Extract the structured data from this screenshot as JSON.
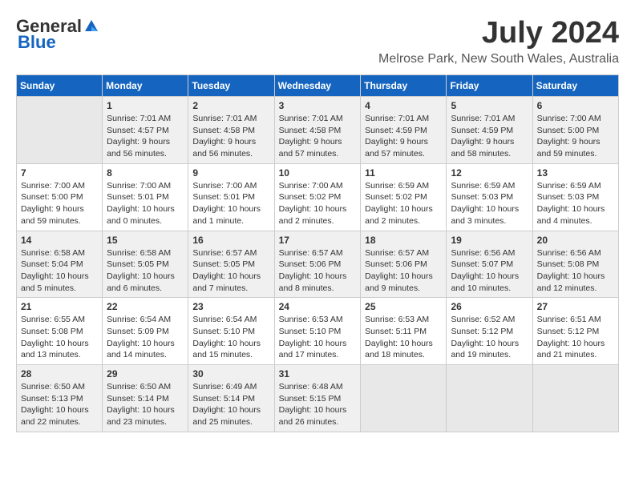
{
  "header": {
    "logo": {
      "general": "General",
      "blue": "Blue"
    },
    "title": "July 2024",
    "location": "Melrose Park, New South Wales, Australia"
  },
  "calendar": {
    "weekdays": [
      "Sunday",
      "Monday",
      "Tuesday",
      "Wednesday",
      "Thursday",
      "Friday",
      "Saturday"
    ],
    "weeks": [
      [
        {
          "day": "",
          "info": ""
        },
        {
          "day": "1",
          "info": "Sunrise: 7:01 AM\nSunset: 4:57 PM\nDaylight: 9 hours\nand 56 minutes."
        },
        {
          "day": "2",
          "info": "Sunrise: 7:01 AM\nSunset: 4:58 PM\nDaylight: 9 hours\nand 56 minutes."
        },
        {
          "day": "3",
          "info": "Sunrise: 7:01 AM\nSunset: 4:58 PM\nDaylight: 9 hours\nand 57 minutes."
        },
        {
          "day": "4",
          "info": "Sunrise: 7:01 AM\nSunset: 4:59 PM\nDaylight: 9 hours\nand 57 minutes."
        },
        {
          "day": "5",
          "info": "Sunrise: 7:01 AM\nSunset: 4:59 PM\nDaylight: 9 hours\nand 58 minutes."
        },
        {
          "day": "6",
          "info": "Sunrise: 7:00 AM\nSunset: 5:00 PM\nDaylight: 9 hours\nand 59 minutes."
        }
      ],
      [
        {
          "day": "7",
          "info": "Sunrise: 7:00 AM\nSunset: 5:00 PM\nDaylight: 9 hours\nand 59 minutes."
        },
        {
          "day": "8",
          "info": "Sunrise: 7:00 AM\nSunset: 5:01 PM\nDaylight: 10 hours\nand 0 minutes."
        },
        {
          "day": "9",
          "info": "Sunrise: 7:00 AM\nSunset: 5:01 PM\nDaylight: 10 hours\nand 1 minute."
        },
        {
          "day": "10",
          "info": "Sunrise: 7:00 AM\nSunset: 5:02 PM\nDaylight: 10 hours\nand 2 minutes."
        },
        {
          "day": "11",
          "info": "Sunrise: 6:59 AM\nSunset: 5:02 PM\nDaylight: 10 hours\nand 2 minutes."
        },
        {
          "day": "12",
          "info": "Sunrise: 6:59 AM\nSunset: 5:03 PM\nDaylight: 10 hours\nand 3 minutes."
        },
        {
          "day": "13",
          "info": "Sunrise: 6:59 AM\nSunset: 5:03 PM\nDaylight: 10 hours\nand 4 minutes."
        }
      ],
      [
        {
          "day": "14",
          "info": "Sunrise: 6:58 AM\nSunset: 5:04 PM\nDaylight: 10 hours\nand 5 minutes."
        },
        {
          "day": "15",
          "info": "Sunrise: 6:58 AM\nSunset: 5:05 PM\nDaylight: 10 hours\nand 6 minutes."
        },
        {
          "day": "16",
          "info": "Sunrise: 6:57 AM\nSunset: 5:05 PM\nDaylight: 10 hours\nand 7 minutes."
        },
        {
          "day": "17",
          "info": "Sunrise: 6:57 AM\nSunset: 5:06 PM\nDaylight: 10 hours\nand 8 minutes."
        },
        {
          "day": "18",
          "info": "Sunrise: 6:57 AM\nSunset: 5:06 PM\nDaylight: 10 hours\nand 9 minutes."
        },
        {
          "day": "19",
          "info": "Sunrise: 6:56 AM\nSunset: 5:07 PM\nDaylight: 10 hours\nand 10 minutes."
        },
        {
          "day": "20",
          "info": "Sunrise: 6:56 AM\nSunset: 5:08 PM\nDaylight: 10 hours\nand 12 minutes."
        }
      ],
      [
        {
          "day": "21",
          "info": "Sunrise: 6:55 AM\nSunset: 5:08 PM\nDaylight: 10 hours\nand 13 minutes."
        },
        {
          "day": "22",
          "info": "Sunrise: 6:54 AM\nSunset: 5:09 PM\nDaylight: 10 hours\nand 14 minutes."
        },
        {
          "day": "23",
          "info": "Sunrise: 6:54 AM\nSunset: 5:10 PM\nDaylight: 10 hours\nand 15 minutes."
        },
        {
          "day": "24",
          "info": "Sunrise: 6:53 AM\nSunset: 5:10 PM\nDaylight: 10 hours\nand 17 minutes."
        },
        {
          "day": "25",
          "info": "Sunrise: 6:53 AM\nSunset: 5:11 PM\nDaylight: 10 hours\nand 18 minutes."
        },
        {
          "day": "26",
          "info": "Sunrise: 6:52 AM\nSunset: 5:12 PM\nDaylight: 10 hours\nand 19 minutes."
        },
        {
          "day": "27",
          "info": "Sunrise: 6:51 AM\nSunset: 5:12 PM\nDaylight: 10 hours\nand 21 minutes."
        }
      ],
      [
        {
          "day": "28",
          "info": "Sunrise: 6:50 AM\nSunset: 5:13 PM\nDaylight: 10 hours\nand 22 minutes."
        },
        {
          "day": "29",
          "info": "Sunrise: 6:50 AM\nSunset: 5:14 PM\nDaylight: 10 hours\nand 23 minutes."
        },
        {
          "day": "30",
          "info": "Sunrise: 6:49 AM\nSunset: 5:14 PM\nDaylight: 10 hours\nand 25 minutes."
        },
        {
          "day": "31",
          "info": "Sunrise: 6:48 AM\nSunset: 5:15 PM\nDaylight: 10 hours\nand 26 minutes."
        },
        {
          "day": "",
          "info": ""
        },
        {
          "day": "",
          "info": ""
        },
        {
          "day": "",
          "info": ""
        }
      ]
    ]
  }
}
